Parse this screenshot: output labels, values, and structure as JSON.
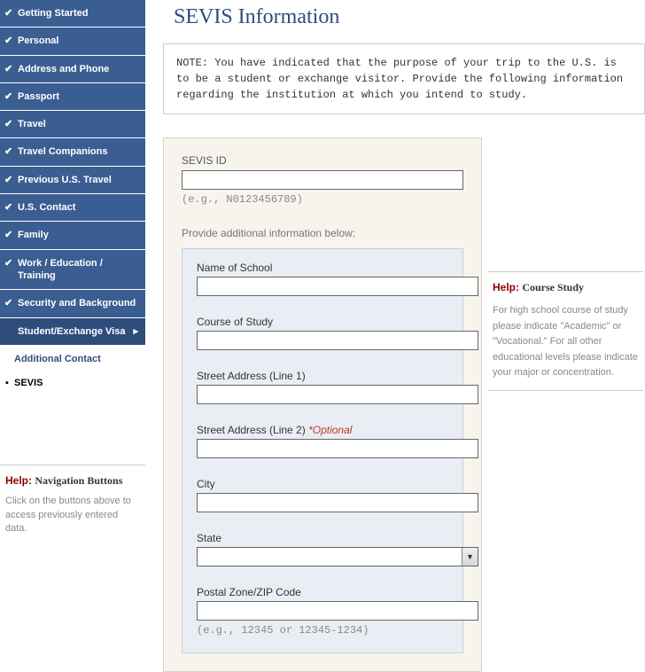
{
  "sidebar": {
    "items": [
      {
        "label": "Getting Started",
        "done": true
      },
      {
        "label": "Personal",
        "done": true
      },
      {
        "label": "Address and Phone",
        "done": true
      },
      {
        "label": "Passport",
        "done": true
      },
      {
        "label": "Travel",
        "done": true
      },
      {
        "label": "Travel Companions",
        "done": true
      },
      {
        "label": "Previous U.S. Travel",
        "done": true
      },
      {
        "label": "U.S. Contact",
        "done": true
      },
      {
        "label": "Family",
        "done": true
      },
      {
        "label": "Work / Education / Training",
        "done": true
      },
      {
        "label": "Security and Background",
        "done": true
      },
      {
        "label": "Student/Exchange Visa",
        "active": true
      }
    ],
    "sub": {
      "additional": "Additional Contact",
      "current": "SEVIS"
    },
    "help": {
      "label": "Help:",
      "title": "Navigation Buttons",
      "text": "Click on the buttons above to access previously entered data."
    }
  },
  "page": {
    "title": "SEVIS Information",
    "note": "NOTE: You have indicated that the purpose of your trip to the U.S. is to be a student or exchange visitor. Provide the following information regarding the institution at which you intend to study."
  },
  "form": {
    "sevis_label": "SEVIS ID",
    "sevis_value": "",
    "sevis_hint": "(e.g., N0123456789)",
    "section_text": "Provide additional information below:",
    "school_label": "Name of School",
    "school_value": "",
    "course_label": "Course of Study",
    "course_value": "",
    "addr1_label": "Street Address (Line 1)",
    "addr1_value": "",
    "addr2_label": "Street Address (Line 2)",
    "addr2_optional": " *Optional",
    "addr2_value": "",
    "city_label": "City",
    "city_value": "",
    "state_label": "State",
    "state_value": "",
    "zip_label": "Postal Zone/ZIP Code",
    "zip_value": "",
    "zip_hint": "(e.g., 12345 or 12345-1234)"
  },
  "right_help": {
    "label": "Help:",
    "title": "Course Study",
    "text": "For high school course of study please indicate \"Academic\" or \"Vocational.\" For all other educational levels please indicate your major or concentration."
  }
}
